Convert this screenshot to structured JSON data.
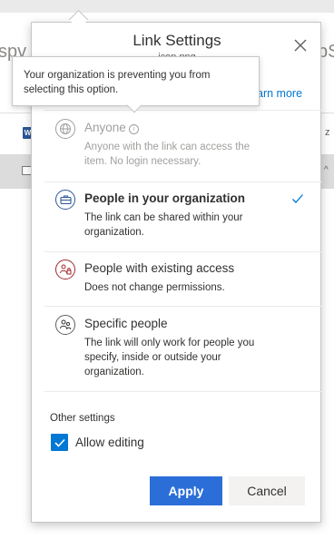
{
  "background": {
    "left_fragment": "spv",
    "right_fragment": "pS",
    "doc_icon_letter": "W",
    "edge_glyph": "z",
    "edge_caret": "^"
  },
  "dialog": {
    "title": "Link Settings",
    "subtitle": "icon.png",
    "learn_more": "arn more",
    "options": [
      {
        "title": "Anyone",
        "description": "Anyone with the link can access the item. No login necessary.",
        "state": "disabled",
        "icon": "globe-icon"
      },
      {
        "title": "People in your organization",
        "description": "The link can be shared within your organization.",
        "state": "selected",
        "icon": "briefcase-icon"
      },
      {
        "title": "People with existing access",
        "description": "Does not change permissions.",
        "state": "normal",
        "icon": "people-lock-icon"
      },
      {
        "title": "Specific people",
        "description": "The link will only work for people you specify, inside or outside your organization.",
        "state": "normal",
        "icon": "people-icon"
      }
    ],
    "other_settings": {
      "label": "Other settings",
      "allow_editing_label": "Allow editing",
      "allow_editing_checked": true
    },
    "buttons": {
      "apply": "Apply",
      "cancel": "Cancel"
    }
  },
  "tooltip": {
    "text": "Your organization is preventing you from selecting this option."
  },
  "colors": {
    "accent": "#0078d4",
    "apply_button": "#2b6ed8",
    "selected_icon": "#2b579a",
    "existing_access_icon": "#a4262c",
    "disabled_text": "#a19f9d"
  }
}
